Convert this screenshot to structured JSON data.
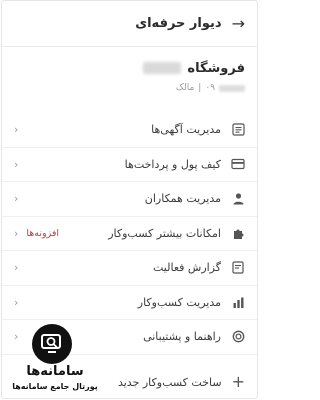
{
  "header": {
    "title": "دیوار حرفه‌ای"
  },
  "store": {
    "name": "فروشگاه",
    "meta_prefix": "۰۹",
    "separator": "|",
    "role": "مالک"
  },
  "menu": {
    "items": [
      {
        "label": "مدیریت آگهی‌ها",
        "icon": "list-icon"
      },
      {
        "label": "کیف پول و پرداخت‌ها",
        "icon": "card-icon"
      },
      {
        "label": "مدیریت همکاران",
        "icon": "person-icon"
      },
      {
        "label": "امکانات بیشتر کسب‌وکار",
        "icon": "puzzle-icon",
        "badge": "افزونه‌ها"
      },
      {
        "label": "گزارش فعالیت",
        "icon": "report-icon"
      },
      {
        "label": "مدیریت کسب‌وکار",
        "icon": "chart-icon"
      },
      {
        "label": "راهنما و پشتیبانی",
        "icon": "support-icon"
      }
    ]
  },
  "new_business": {
    "label": "ساخت کسب‌وکار جدید"
  },
  "watermark": {
    "name": "سامانه‌ها",
    "subtitle": "پورتال جامع سامانه‌ها"
  },
  "colors": {
    "badge": "#c03a3a",
    "text": "#3a3a3a"
  }
}
